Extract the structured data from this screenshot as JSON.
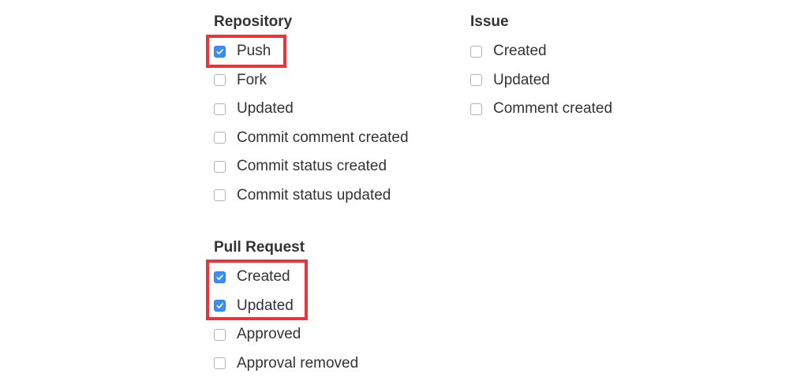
{
  "groups": {
    "repository": {
      "title": "Repository",
      "options": [
        {
          "label": "Push",
          "checked": true
        },
        {
          "label": "Fork",
          "checked": false
        },
        {
          "label": "Updated",
          "checked": false
        },
        {
          "label": "Commit comment created",
          "checked": false
        },
        {
          "label": "Commit status created",
          "checked": false
        },
        {
          "label": "Commit status updated",
          "checked": false
        }
      ]
    },
    "issue": {
      "title": "Issue",
      "options": [
        {
          "label": "Created",
          "checked": false
        },
        {
          "label": "Updated",
          "checked": false
        },
        {
          "label": "Comment created",
          "checked": false
        }
      ]
    },
    "pull_request": {
      "title": "Pull Request",
      "options": [
        {
          "label": "Created",
          "checked": true
        },
        {
          "label": "Updated",
          "checked": true
        },
        {
          "label": "Approved",
          "checked": false
        },
        {
          "label": "Approval removed",
          "checked": false
        }
      ]
    }
  },
  "colors": {
    "checked_fill": "#3b8ff0",
    "highlight": "#e8353b",
    "text": "#333333"
  },
  "icons": {
    "check": "checkmark-icon"
  }
}
